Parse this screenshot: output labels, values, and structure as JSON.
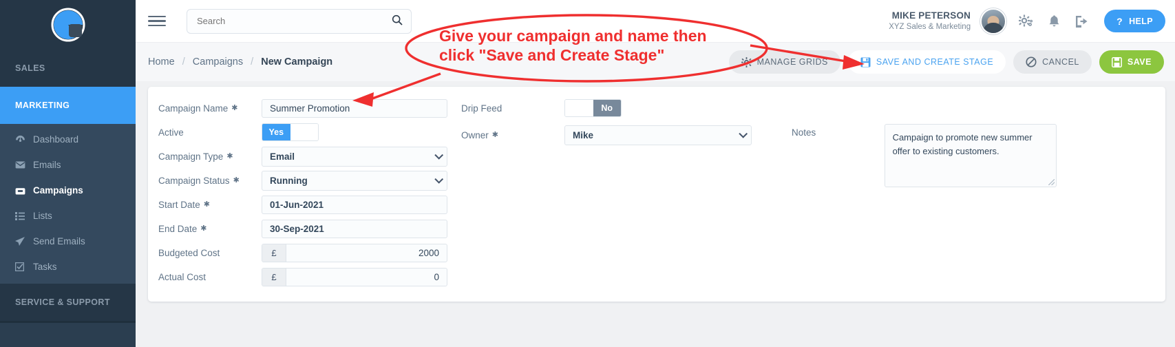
{
  "sidebar": {
    "logo_icon": "pie-chart-logo",
    "sections": [
      {
        "label": "SALES",
        "active": false
      },
      {
        "label": "MARKETING",
        "active": true
      },
      {
        "label": "SERVICE & SUPPORT",
        "active": false
      }
    ],
    "items": [
      {
        "label": "Dashboard",
        "icon": "speedometer-icon",
        "glyph": "◔",
        "active": false
      },
      {
        "label": "Emails",
        "icon": "envelope-icon",
        "glyph": "✉",
        "active": false
      },
      {
        "label": "Campaigns",
        "icon": "inbox-icon",
        "glyph": "⌸",
        "active": true
      },
      {
        "label": "Lists",
        "icon": "list-icon",
        "glyph": "☰",
        "active": false
      },
      {
        "label": "Send Emails",
        "icon": "paper-plane-icon",
        "glyph": "➤",
        "active": false
      },
      {
        "label": "Tasks",
        "icon": "check-square-icon",
        "glyph": "☑",
        "active": false
      }
    ]
  },
  "topbar": {
    "menu_icon": "hamburger-menu-icon",
    "search": {
      "placeholder": "Search",
      "value": "",
      "icon": "search-icon"
    },
    "user": {
      "name": "MIKE PETERSON",
      "org": "XYZ Sales & Marketing",
      "avatar": "user-avatar"
    },
    "icons": [
      {
        "name": "settings-gears-icon",
        "glyph": "⚙"
      },
      {
        "name": "notification-bell-icon",
        "glyph": "🔔"
      },
      {
        "name": "logout-icon",
        "glyph": "↪"
      }
    ],
    "help": {
      "label": "HELP",
      "q": "?",
      "color": "#3c9ef5"
    }
  },
  "breadcrumb": {
    "items": [
      "Home",
      "Campaigns",
      "New Campaign"
    ],
    "separator": "/"
  },
  "actions": [
    {
      "label": "MANAGE GRIDS",
      "icon": "grid-gear-icon",
      "glyph": "⚙",
      "style": "grey"
    },
    {
      "label": "SAVE AND CREATE STAGE",
      "icon": "save-disk-icon",
      "glyph": "💾",
      "style": "white"
    },
    {
      "label": "CANCEL",
      "icon": "cancel-circle-icon",
      "glyph": "⊘",
      "style": "cancel"
    },
    {
      "label": "SAVE",
      "icon": "floppy-disk-icon",
      "glyph": "💾",
      "style": "save"
    }
  ],
  "form": {
    "column1": {
      "campaign_name": {
        "label": "Campaign Name",
        "required": true,
        "value": "Summer Promotion"
      },
      "active": {
        "label": "Active",
        "required": false,
        "on_label": "Yes",
        "off_label": "",
        "state": "yes"
      },
      "campaign_type": {
        "label": "Campaign Type",
        "required": true,
        "value": "Email"
      },
      "campaign_status": {
        "label": "Campaign Status",
        "required": true,
        "value": "Running"
      },
      "start_date": {
        "label": "Start Date",
        "required": true,
        "value": "01-Jun-2021"
      },
      "end_date": {
        "label": "End Date",
        "required": true,
        "value": "30-Sep-2021"
      },
      "budgeted_cost": {
        "label": "Budgeted Cost",
        "required": false,
        "symbol": "£",
        "value": "2000"
      },
      "actual_cost": {
        "label": "Actual Cost",
        "required": false,
        "symbol": "£",
        "value": "0"
      }
    },
    "column2": {
      "drip_feed": {
        "label": "Drip Feed",
        "required": false,
        "on_label": "",
        "off_label": "No",
        "state": "no"
      },
      "owner": {
        "label": "Owner",
        "required": true,
        "value": "Mike"
      }
    },
    "column3": {
      "notes": {
        "label": "Notes",
        "value": "Campaign to promote new summer offer to existing customers."
      }
    }
  },
  "annotation": {
    "line1": "Give your campaign and name then",
    "line2": "click \"Save and Create Stage\"",
    "color": "#ef2f2f"
  },
  "colors": {
    "sidebar_dark": "#253646",
    "sidebar_mid": "#34495e",
    "accent_blue": "#3c9ef5",
    "save_green": "#8cc63f",
    "annotation_red": "#ef2f2f"
  }
}
